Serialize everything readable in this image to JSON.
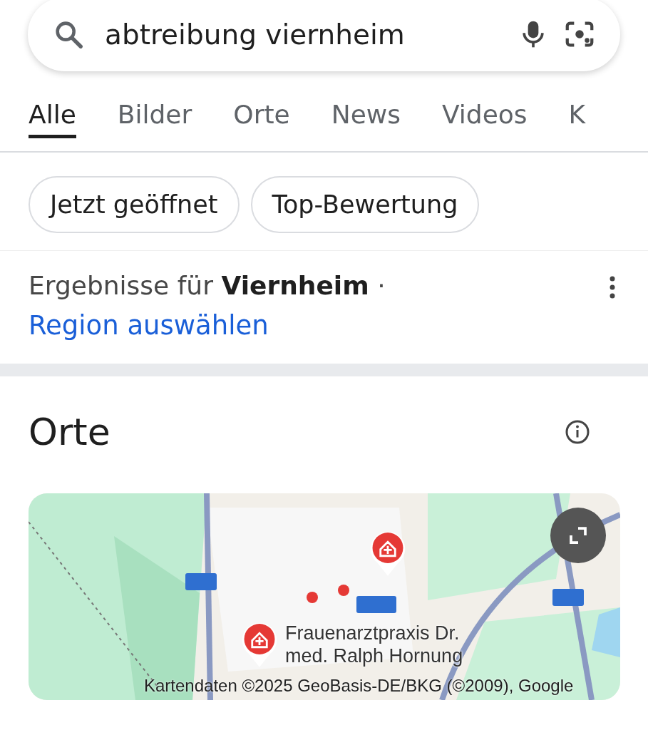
{
  "search": {
    "value": "abtreibung viernheim"
  },
  "tabs": [
    {
      "label": "Alle",
      "selected": true
    },
    {
      "label": "Bilder",
      "selected": false
    },
    {
      "label": "Orte",
      "selected": false
    },
    {
      "label": "News",
      "selected": false
    },
    {
      "label": "Videos",
      "selected": false
    },
    {
      "label": "K",
      "selected": false
    }
  ],
  "chips": [
    "Jetzt geöffnet",
    "Top-Bewertung"
  ],
  "results_for": {
    "text": "Ergebnisse für **Viernheim** ·",
    "link": "Region auswählen"
  },
  "places": {
    "title": "Orte",
    "map": {
      "kind": "picture",
      "pin_label": "Frauenarztpraxis Dr. med. Ralph Hornung",
      "attribution": "Kartendaten ©2025 GeoBasis-DE/BKG (©2009), Google"
    }
  }
}
